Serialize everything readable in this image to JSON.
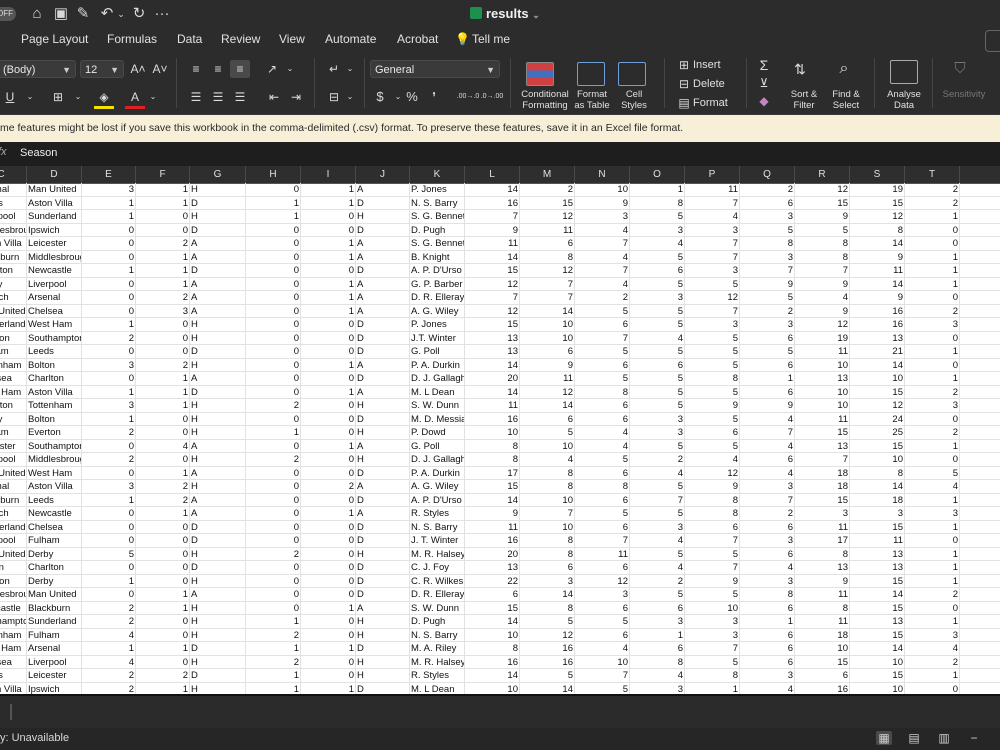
{
  "titlebar": {
    "autosave": "OFF",
    "doc_title": "results",
    "more": "···"
  },
  "menu": [
    "Page Layout",
    "Formulas",
    "Data",
    "Review",
    "View",
    "Automate",
    "Acrobat",
    "Tell me"
  ],
  "ribbon": {
    "font_name": "(Body)",
    "font_size": "12",
    "grow_font": "A˄",
    "shrink_font": "A˅",
    "number_format": "General",
    "currency": "$",
    "percent": "%",
    "comma": "ʼ",
    "inc_decimal": ".00→.0",
    "dec_decimal": ".0→.00",
    "conditional_formatting": "Conditional\nFormatting",
    "format_as_table": "Format\nas Table",
    "cell_styles": "Cell\nStyles",
    "insert": "Insert",
    "delete": "Delete",
    "format": "Format",
    "sort_filter": "Sort &\nFilter",
    "find_select": "Find &\nSelect",
    "analyse_data": "Analyse\nData",
    "sensitivity": "Sensitivity"
  },
  "notice": "me features might be lost if you save this workbook in the comma-delimited (.csv) format. To preserve these features, save it in an Excel file format.",
  "formula_bar": {
    "fx": "fx",
    "content": "Season"
  },
  "columns": [
    "C",
    "D",
    "E",
    "F",
    "G",
    "H",
    "I",
    "J",
    "K",
    "L",
    "M",
    "N",
    "O",
    "P",
    "Q",
    "R",
    "S",
    "T"
  ],
  "rows": [
    [
      "Arsenal",
      "Man United",
      "3",
      "1",
      "H",
      "0",
      "1",
      "A",
      "P. Jones",
      "14",
      "2",
      "10",
      "1",
      "11",
      "2",
      "12",
      "19",
      "2"
    ],
    [
      "Leeds",
      "Aston Villa",
      "1",
      "1",
      "D",
      "1",
      "1",
      "D",
      "N. S. Barry",
      "16",
      "15",
      "9",
      "8",
      "7",
      "6",
      "15",
      "15",
      "2"
    ],
    [
      "Liverpool",
      "Sunderland",
      "1",
      "0",
      "H",
      "1",
      "0",
      "H",
      "S. G. Bennett",
      "7",
      "12",
      "3",
      "5",
      "4",
      "3",
      "9",
      "12",
      "1"
    ],
    [
      "Middlesbrough",
      "Ipswich",
      "0",
      "0",
      "D",
      "0",
      "0",
      "D",
      "D. Pugh",
      "9",
      "11",
      "4",
      "3",
      "3",
      "5",
      "5",
      "8",
      "0"
    ],
    [
      "Aston Villa",
      "Leicester",
      "0",
      "2",
      "A",
      "0",
      "1",
      "A",
      "S. G. Bennett",
      "11",
      "6",
      "7",
      "4",
      "7",
      "8",
      "8",
      "14",
      "0"
    ],
    [
      "Blackburn",
      "Middlesbrough",
      "0",
      "1",
      "A",
      "0",
      "1",
      "A",
      "B. Knight",
      "14",
      "8",
      "4",
      "5",
      "7",
      "3",
      "8",
      "9",
      "1"
    ],
    [
      "Charlton",
      "Newcastle",
      "1",
      "1",
      "D",
      "0",
      "0",
      "D",
      "A. P. D'Urso",
      "15",
      "12",
      "7",
      "6",
      "3",
      "7",
      "7",
      "11",
      "1"
    ],
    [
      "Derby",
      "Liverpool",
      "0",
      "1",
      "A",
      "0",
      "1",
      "A",
      "G. P. Barber",
      "12",
      "7",
      "4",
      "5",
      "5",
      "9",
      "9",
      "14",
      "1"
    ],
    [
      "Ipswich",
      "Arsenal",
      "0",
      "2",
      "A",
      "0",
      "1",
      "A",
      "D. R. Elleray",
      "7",
      "7",
      "2",
      "3",
      "12",
      "5",
      "4",
      "9",
      "0"
    ],
    [
      "Man United",
      "Chelsea",
      "0",
      "3",
      "A",
      "0",
      "1",
      "A",
      "A. G. Wiley",
      "12",
      "14",
      "5",
      "5",
      "7",
      "2",
      "9",
      "16",
      "2"
    ],
    [
      "Sunderland",
      "West Ham",
      "1",
      "0",
      "H",
      "0",
      "0",
      "D",
      "P. Jones",
      "15",
      "10",
      "6",
      "5",
      "3",
      "3",
      "12",
      "16",
      "3"
    ],
    [
      "Everton",
      "Southampton",
      "2",
      "0",
      "H",
      "0",
      "0",
      "D",
      "J.T. Winter",
      "13",
      "10",
      "7",
      "4",
      "5",
      "6",
      "19",
      "13",
      "0"
    ],
    [
      "Fulham",
      "Leeds",
      "0",
      "0",
      "D",
      "0",
      "0",
      "D",
      "G. Poll",
      "13",
      "6",
      "5",
      "5",
      "5",
      "5",
      "11",
      "21",
      "1"
    ],
    [
      "Tottenham",
      "Bolton",
      "3",
      "2",
      "H",
      "0",
      "1",
      "A",
      "P. A. Durkin",
      "14",
      "9",
      "6",
      "6",
      "5",
      "6",
      "10",
      "14",
      "0"
    ],
    [
      "Chelsea",
      "Charlton",
      "0",
      "1",
      "A",
      "0",
      "0",
      "D",
      "D. J. Gallagher",
      "20",
      "11",
      "5",
      "5",
      "8",
      "1",
      "13",
      "10",
      "1"
    ],
    [
      "West Ham",
      "Aston Villa",
      "1",
      "1",
      "D",
      "0",
      "1",
      "A",
      "M. L Dean",
      "14",
      "12",
      "8",
      "5",
      "5",
      "6",
      "10",
      "15",
      "2"
    ],
    [
      "Charlton",
      "Tottenham",
      "3",
      "1",
      "H",
      "2",
      "0",
      "H",
      "S. W. Dunn",
      "11",
      "14",
      "6",
      "5",
      "9",
      "9",
      "10",
      "12",
      "3"
    ],
    [
      "Derby",
      "Bolton",
      "1",
      "0",
      "H",
      "0",
      "0",
      "D",
      "M. D. Messias",
      "16",
      "6",
      "6",
      "3",
      "5",
      "4",
      "11",
      "24",
      "0"
    ],
    [
      "Fulham",
      "Everton",
      "2",
      "0",
      "H",
      "1",
      "0",
      "H",
      "P. Dowd",
      "10",
      "5",
      "4",
      "3",
      "6",
      "7",
      "15",
      "25",
      "2"
    ],
    [
      "Leicester",
      "Southampton",
      "0",
      "4",
      "A",
      "0",
      "1",
      "A",
      "G. Poll",
      "8",
      "10",
      "4",
      "5",
      "5",
      "4",
      "13",
      "15",
      "1"
    ],
    [
      "Liverpool",
      "Middlesbrough",
      "2",
      "0",
      "H",
      "2",
      "0",
      "H",
      "D. J. Gallagher",
      "8",
      "4",
      "5",
      "2",
      "4",
      "6",
      "7",
      "10",
      "0"
    ],
    [
      "Man United",
      "West Ham",
      "0",
      "1",
      "A",
      "0",
      "0",
      "D",
      "P. A. Durkin",
      "17",
      "8",
      "6",
      "4",
      "12",
      "4",
      "18",
      "8",
      "5"
    ],
    [
      "Arsenal",
      "Aston Villa",
      "3",
      "2",
      "H",
      "0",
      "2",
      "A",
      "A. G. Wiley",
      "15",
      "8",
      "8",
      "5",
      "9",
      "3",
      "18",
      "14",
      "4"
    ],
    [
      "Blackburn",
      "Leeds",
      "1",
      "2",
      "A",
      "0",
      "0",
      "D",
      "A. P. D'Urso",
      "14",
      "10",
      "6",
      "7",
      "8",
      "7",
      "15",
      "18",
      "1"
    ],
    [
      "Ipswich",
      "Newcastle",
      "0",
      "1",
      "A",
      "0",
      "1",
      "A",
      "R. Styles",
      "9",
      "7",
      "5",
      "5",
      "8",
      "2",
      "3",
      "3",
      "3"
    ],
    [
      "Sunderland",
      "Chelsea",
      "0",
      "0",
      "D",
      "0",
      "0",
      "D",
      "N. S. Barry",
      "11",
      "10",
      "6",
      "3",
      "6",
      "6",
      "11",
      "15",
      "1"
    ],
    [
      "Liverpool",
      "Fulham",
      "0",
      "0",
      "D",
      "0",
      "0",
      "D",
      "J. T. Winter",
      "16",
      "8",
      "7",
      "4",
      "7",
      "3",
      "17",
      "11",
      "0"
    ],
    [
      "Man United",
      "Derby",
      "5",
      "0",
      "H",
      "2",
      "0",
      "H",
      "M. R. Halsey",
      "20",
      "8",
      "11",
      "5",
      "5",
      "6",
      "8",
      "13",
      "1"
    ],
    [
      "Bolton",
      "Charlton",
      "0",
      "0",
      "D",
      "0",
      "0",
      "D",
      "C. J. Foy",
      "13",
      "6",
      "6",
      "4",
      "7",
      "4",
      "13",
      "13",
      "1"
    ],
    [
      "Everton",
      "Derby",
      "1",
      "0",
      "H",
      "0",
      "0",
      "D",
      "C. R. Wilkes",
      "22",
      "3",
      "12",
      "2",
      "9",
      "3",
      "9",
      "15",
      "1"
    ],
    [
      "Middlesbrough",
      "Man United",
      "0",
      "1",
      "A",
      "0",
      "0",
      "D",
      "D. R. Elleray",
      "6",
      "14",
      "3",
      "5",
      "5",
      "8",
      "11",
      "14",
      "2"
    ],
    [
      "Newcastle",
      "Blackburn",
      "2",
      "1",
      "H",
      "0",
      "1",
      "A",
      "S. W. Dunn",
      "15",
      "8",
      "6",
      "6",
      "10",
      "6",
      "8",
      "15",
      "0"
    ],
    [
      "Southampton",
      "Sunderland",
      "2",
      "0",
      "H",
      "1",
      "0",
      "H",
      "D. Pugh",
      "14",
      "5",
      "5",
      "3",
      "3",
      "1",
      "11",
      "13",
      "1"
    ],
    [
      "Tottenham",
      "Fulham",
      "4",
      "0",
      "H",
      "2",
      "0",
      "H",
      "N. S. Barry",
      "10",
      "12",
      "6",
      "1",
      "3",
      "6",
      "18",
      "15",
      "3"
    ],
    [
      "West Ham",
      "Arsenal",
      "1",
      "1",
      "D",
      "1",
      "1",
      "D",
      "M. A. Riley",
      "8",
      "16",
      "4",
      "6",
      "7",
      "6",
      "10",
      "14",
      "4"
    ],
    [
      "Chelsea",
      "Liverpool",
      "4",
      "0",
      "H",
      "2",
      "0",
      "H",
      "M. R. Halsey",
      "16",
      "16",
      "10",
      "8",
      "5",
      "6",
      "15",
      "10",
      "2"
    ],
    [
      "Leeds",
      "Leicester",
      "2",
      "2",
      "D",
      "1",
      "0",
      "H",
      "R. Styles",
      "14",
      "5",
      "7",
      "4",
      "8",
      "3",
      "6",
      "15",
      "1"
    ],
    [
      "Aston Villa",
      "Ipswich",
      "2",
      "1",
      "H",
      "1",
      "1",
      "D",
      "M. L Dean",
      "10",
      "14",
      "5",
      "3",
      "1",
      "4",
      "16",
      "10",
      "0"
    ]
  ],
  "status": "y: Unavailable"
}
